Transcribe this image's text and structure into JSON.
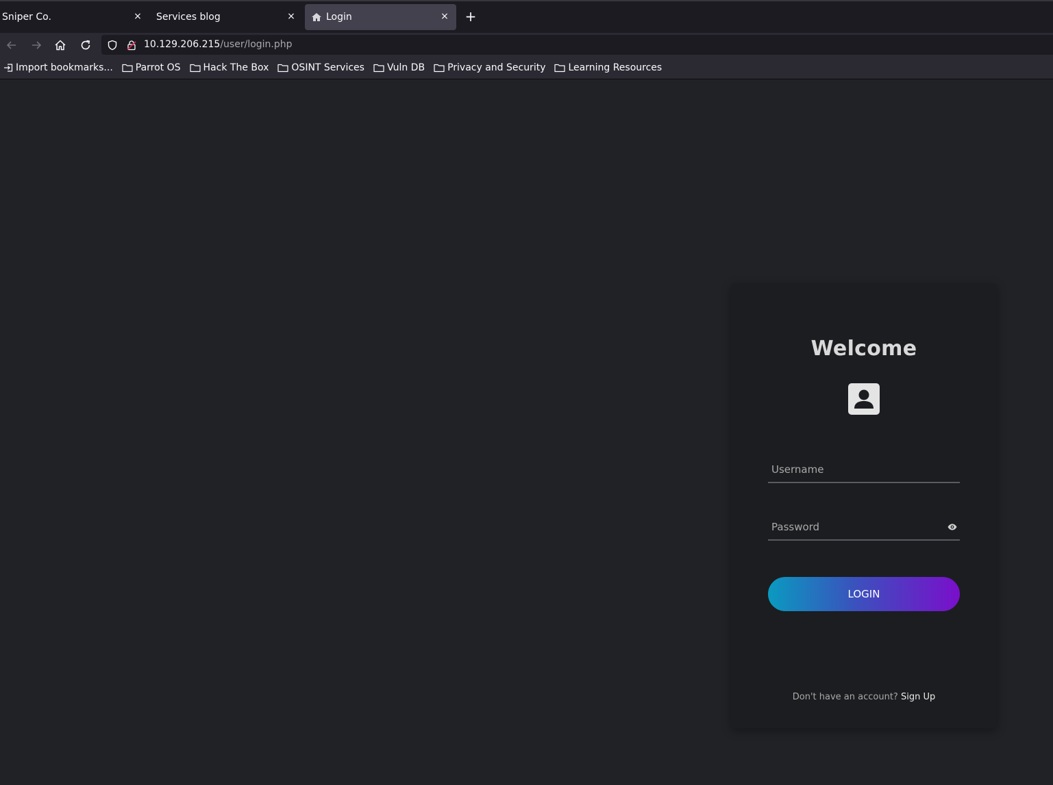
{
  "browser": {
    "tabs": [
      {
        "title": "Sniper Co.",
        "active": false
      },
      {
        "title": "Services blog",
        "active": false
      },
      {
        "title": "Login",
        "active": true
      }
    ],
    "close_glyph": "×",
    "new_tab_glyph": "+",
    "url": {
      "host": "10.129.206.215",
      "path": "/user/login.php"
    },
    "bookmarks": [
      {
        "label": "Import bookmarks...",
        "icon": "import-icon"
      },
      {
        "label": "Parrot OS",
        "icon": "folder-icon"
      },
      {
        "label": "Hack The Box",
        "icon": "folder-icon"
      },
      {
        "label": "OSINT Services",
        "icon": "folder-icon"
      },
      {
        "label": "Vuln DB",
        "icon": "folder-icon"
      },
      {
        "label": "Privacy and Security",
        "icon": "folder-icon"
      },
      {
        "label": "Learning Resources",
        "icon": "folder-icon"
      }
    ]
  },
  "login": {
    "title": "Welcome",
    "username_placeholder": "Username",
    "password_placeholder": "Password",
    "button_label": "LOGIN",
    "signup_prompt": "Don't have an account?",
    "signup_link": "Sign Up"
  },
  "colors": {
    "page_bg": "#212226",
    "card_bg": "#1c1d20",
    "button_gradient_start": "#0a9ac0",
    "button_gradient_end": "#7a0fcb"
  }
}
